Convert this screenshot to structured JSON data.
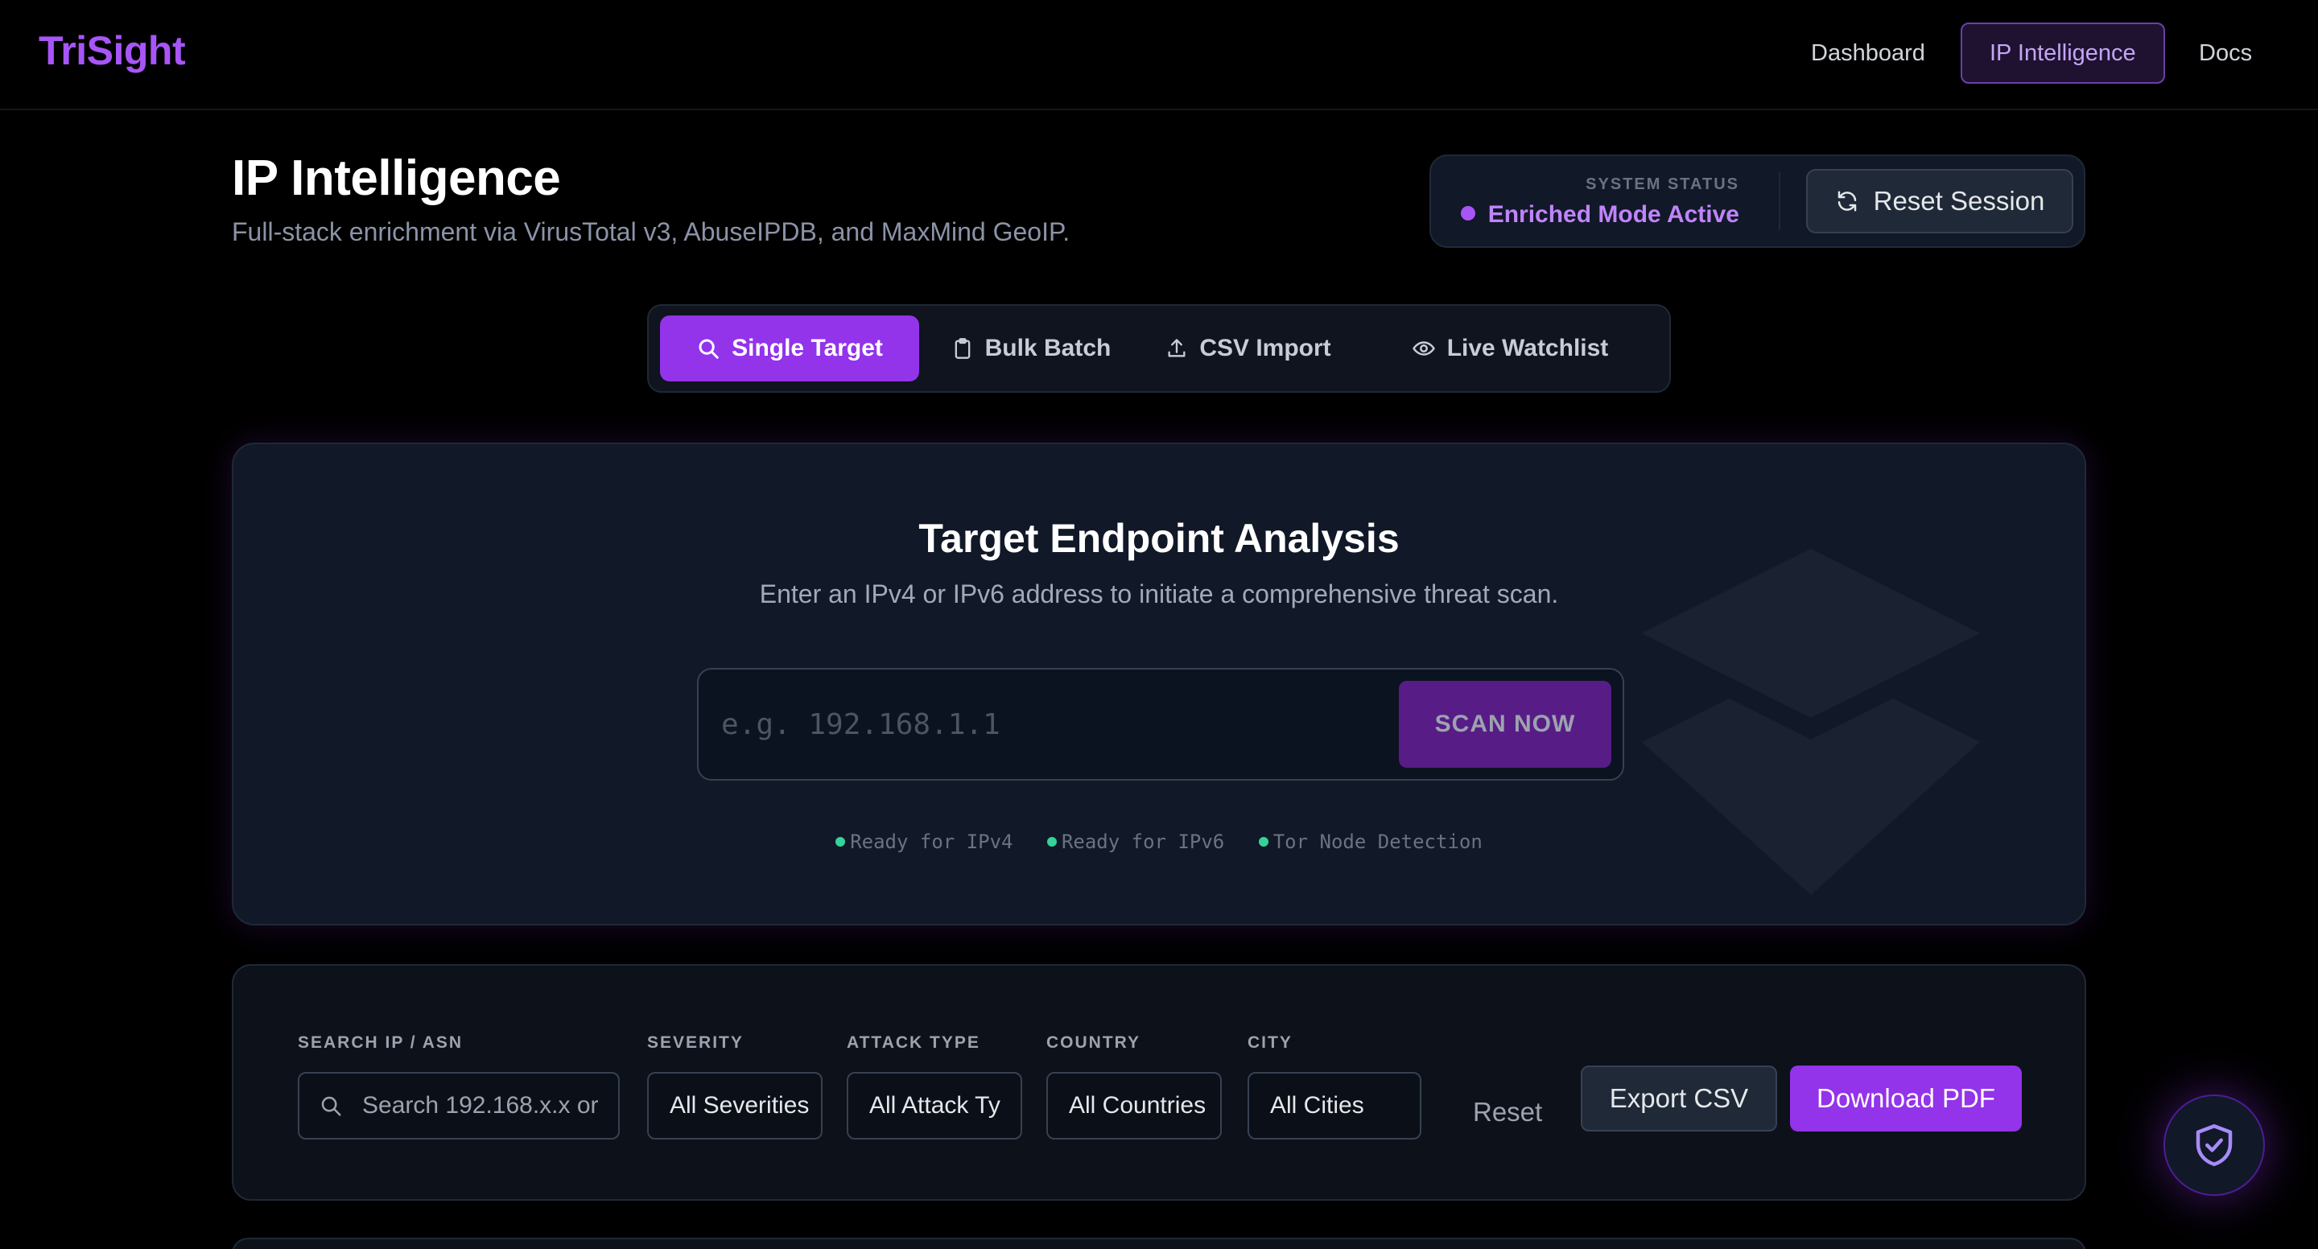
{
  "nav": {
    "brand": "TriSight",
    "links": [
      {
        "label": "Dashboard"
      },
      {
        "label": "IP Intelligence",
        "active": true
      },
      {
        "label": "Docs"
      }
    ]
  },
  "header": {
    "title": "IP Intelligence",
    "subtitle": "Full-stack enrichment via VirusTotal v3, AbuseIPDB, and MaxMind GeoIP.",
    "status_label": "SYSTEM STATUS",
    "status_value": "Enriched Mode Active",
    "reset_session_label": "Reset Session"
  },
  "tabs": [
    {
      "label": "Single Target",
      "icon": "search-icon",
      "active": true
    },
    {
      "label": "Bulk Batch",
      "icon": "clipboard-icon"
    },
    {
      "label": "CSV Import",
      "icon": "upload-icon"
    },
    {
      "label": "Live Watchlist",
      "icon": "eye-icon"
    }
  ],
  "analysis": {
    "title": "Target Endpoint Analysis",
    "subtitle": "Enter an IPv4 or IPv6 address to initiate a comprehensive threat scan.",
    "input_value": "",
    "input_placeholder": "e.g. 192.168.1.1",
    "scan_button": "SCAN NOW",
    "ready_items": [
      "Ready for IPv4",
      "Ready for IPv6",
      "Tor Node Detection"
    ]
  },
  "filters": {
    "search": {
      "label": "SEARCH IP / ASN",
      "placeholder": "Search 192.168.x.x or"
    },
    "severity": {
      "label": "SEVERITY",
      "value": "All Severities"
    },
    "attack_type": {
      "label": "ATTACK TYPE",
      "value": "All Attack Ty"
    },
    "country": {
      "label": "COUNTRY",
      "value": "All Countries"
    },
    "city": {
      "label": "CITY",
      "value": "All Cities"
    },
    "reset_label": "Reset",
    "export_csv_label": "Export CSV",
    "download_pdf_label": "Download PDF"
  },
  "colors": {
    "accent": "#9333ea",
    "brand": "#a855f7",
    "ready_dot": "#34d399",
    "background": "#000000",
    "card": "#111827"
  }
}
